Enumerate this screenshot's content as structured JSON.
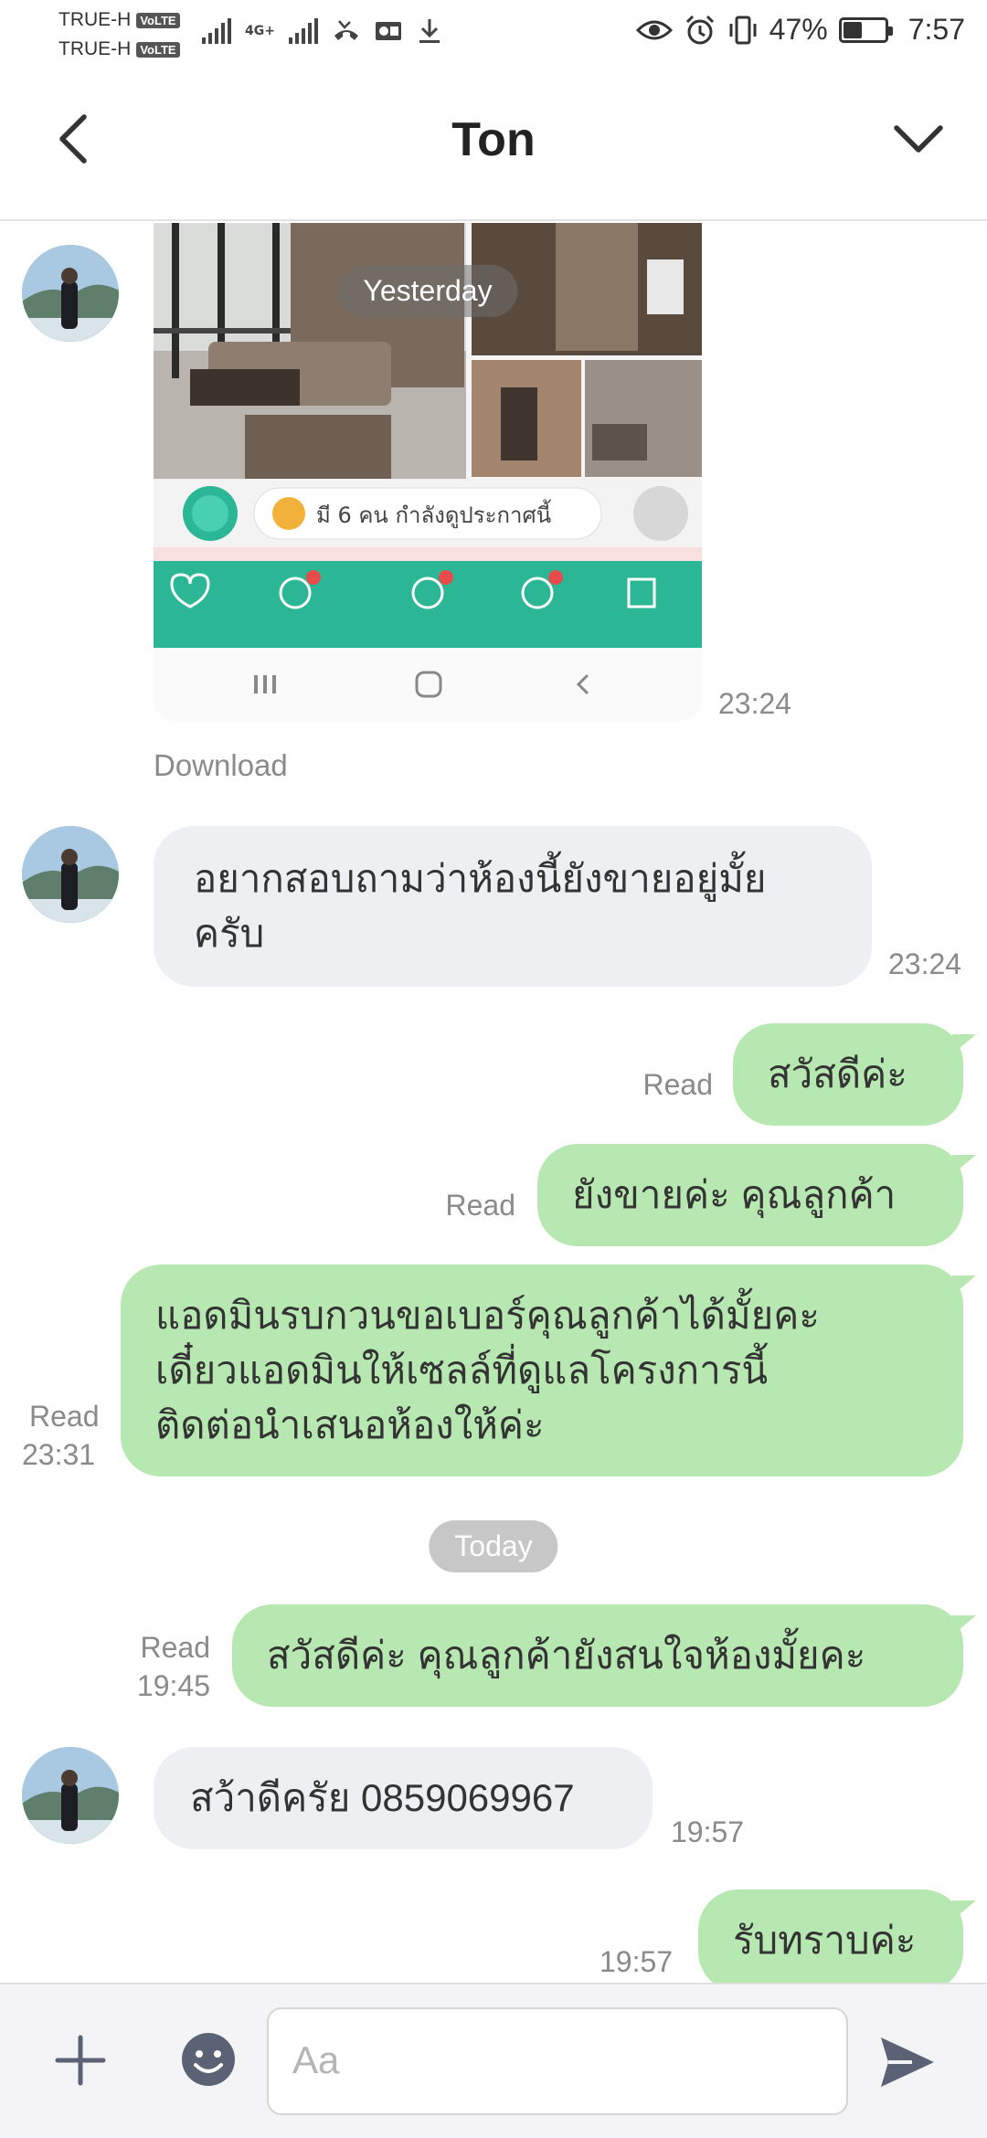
{
  "status_bar": {
    "carrier_1": "TRUE-H",
    "carrier_2": "TRUE-H",
    "volte_label": "VoLTE",
    "network_type": "4G+",
    "battery_percent": "47%",
    "battery_level": 0.47,
    "time": "7:57"
  },
  "header": {
    "title": "Ton"
  },
  "messages": {
    "image_msg": {
      "time": "23:24",
      "download_label": "Download"
    },
    "yesterday_label": "Yesterday",
    "msg1": {
      "text_line1": "อยากสอบถามว่าห้องนี้ยังขายอยู่มั้ย",
      "text_line2": "ครับ",
      "time": "23:24"
    },
    "msg2": {
      "text": "สวัสดีค่ะ",
      "read": "Read"
    },
    "msg3": {
      "text": "ยังขายค่ะ คุณลูกค้า",
      "read": "Read"
    },
    "msg4": {
      "text_line1": "แอดมินรบกวนขอเบอร์คุณลูกค้าได้มั้ยคะ",
      "text_line2": "เดี๋ยวแอดมินให้เซลล์ที่ดูแลโครงการนี้",
      "text_line3": "ติดต่อนำเสนอห้องให้ค่ะ",
      "read": "Read",
      "time": "23:31"
    },
    "today_label": "Today",
    "msg5": {
      "text": "สวัสดีค่ะ คุณลูกค้ายังสนใจห้องมั้ยคะ",
      "read": "Read",
      "time": "19:45"
    },
    "msg6": {
      "text": "สว้าดีครัย 0859069967",
      "time": "19:57"
    },
    "msg7": {
      "text": "รับทราบค่ะ",
      "time": "19:57"
    }
  },
  "shared_image_app": {
    "counter_text": "มี 6 คน กำลังดูประกาศนี้"
  },
  "input": {
    "placeholder": "Aa"
  },
  "colors": {
    "outgoing_bubble": "#b8e8b1",
    "incoming_bubble": "#eeeff2",
    "app_teal": "#2bb795",
    "icon_gray": "#5b6275"
  }
}
